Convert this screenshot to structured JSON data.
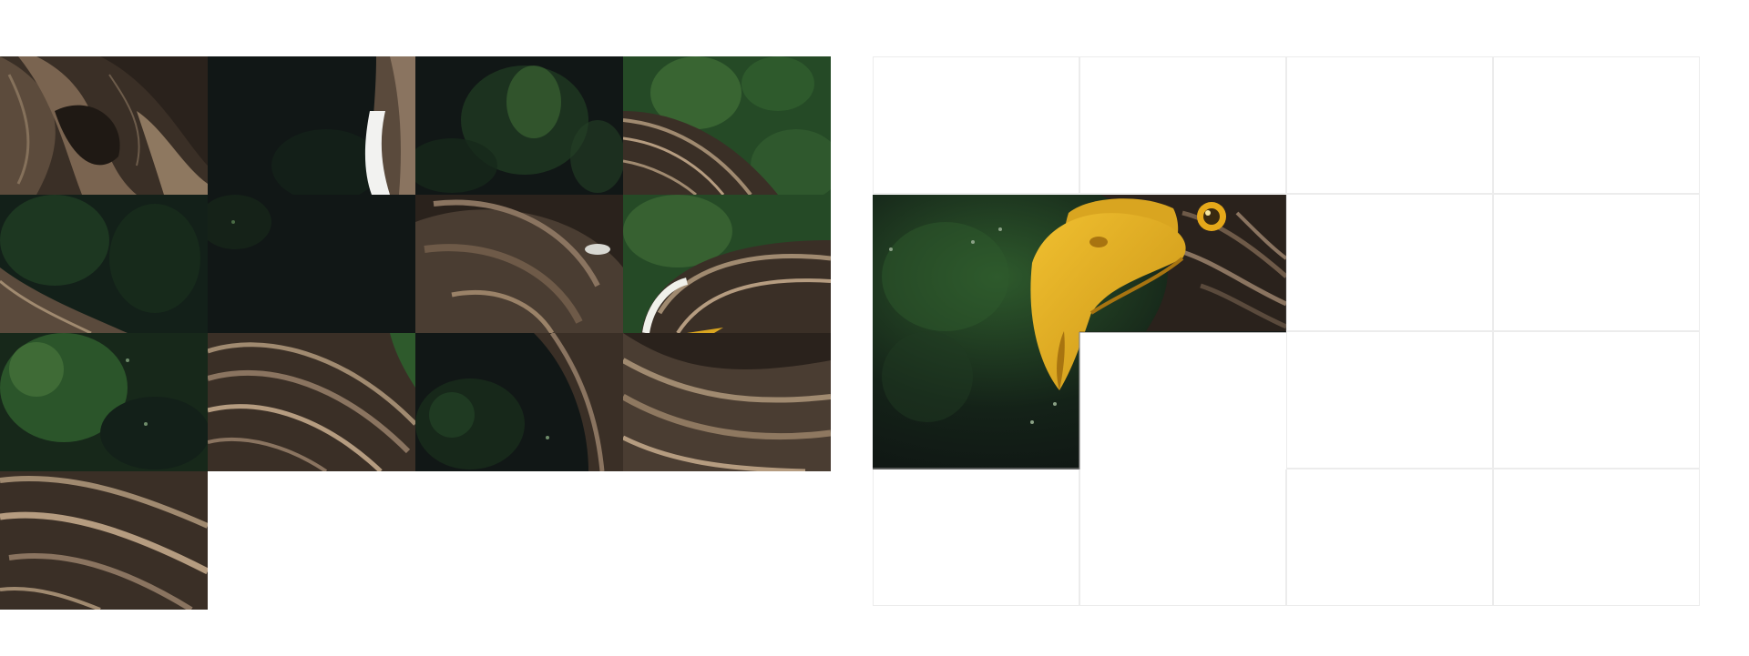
{
  "puzzle": {
    "grid": {
      "rows": 4,
      "cols": 4
    },
    "image_subject": "eagle",
    "colors": {
      "feather_dark": "#2a221c",
      "feather_mid": "#5a4a3c",
      "feather_light": "#a08a70",
      "bg_dark": "#111716",
      "bg_green": "#1f3a22",
      "bg_green_light": "#3f6b36",
      "beak": "#d9a520",
      "beak_shadow": "#b07b10",
      "eye": "#e6a91a",
      "slot_border": "#ececec"
    },
    "tray_pieces": [
      {
        "id": "p1",
        "kind": "feathers-dark",
        "col": 0,
        "row": 0
      },
      {
        "id": "p2",
        "kind": "dark-bg-white-edge",
        "col": 1,
        "row": 0
      },
      {
        "id": "p3",
        "kind": "green-bokeh-dark",
        "col": 2,
        "row": 0
      },
      {
        "id": "p4",
        "kind": "green-feather-tip",
        "col": 3,
        "row": 0
      },
      {
        "id": "p5",
        "kind": "green-bg-feather-corner",
        "col": 0,
        "row": 1
      },
      {
        "id": "p6",
        "kind": "dark-bg",
        "col": 1,
        "row": 1
      },
      {
        "id": "p7",
        "kind": "wing-feathers-curve",
        "col": 2,
        "row": 1
      },
      {
        "id": "p8",
        "kind": "head-feathers-green",
        "col": 3,
        "row": 1
      },
      {
        "id": "p9",
        "kind": "green-bokeh",
        "col": 0,
        "row": 2
      },
      {
        "id": "p10",
        "kind": "feathers-layered",
        "col": 1,
        "row": 2
      },
      {
        "id": "p11",
        "kind": "dark-green-feather-edge",
        "col": 2,
        "row": 2
      },
      {
        "id": "p12",
        "kind": "feathers-wide",
        "col": 3,
        "row": 2
      },
      {
        "id": "p13",
        "kind": "feathers-bottom",
        "col": 0,
        "row": 3
      }
    ],
    "board_slots": [
      {
        "row": 0,
        "col": 0,
        "filled": false
      },
      {
        "row": 0,
        "col": 1,
        "filled": false
      },
      {
        "row": 0,
        "col": 2,
        "filled": false
      },
      {
        "row": 0,
        "col": 3,
        "filled": false
      },
      {
        "row": 1,
        "col": 0,
        "filled": true,
        "piece": "bg-green-left"
      },
      {
        "row": 1,
        "col": 1,
        "filled": true,
        "piece": "beak-head"
      },
      {
        "row": 1,
        "col": 2,
        "filled": false
      },
      {
        "row": 1,
        "col": 3,
        "filled": false
      },
      {
        "row": 2,
        "col": 0,
        "filled": true,
        "piece": "beak-tip-bg"
      },
      {
        "row": 2,
        "col": 1,
        "filled": false
      },
      {
        "row": 2,
        "col": 2,
        "filled": false
      },
      {
        "row": 2,
        "col": 3,
        "filled": false
      },
      {
        "row": 3,
        "col": 0,
        "filled": false
      },
      {
        "row": 3,
        "col": 1,
        "filled": false
      },
      {
        "row": 3,
        "col": 2,
        "filled": false
      },
      {
        "row": 3,
        "col": 3,
        "filled": false
      }
    ]
  }
}
